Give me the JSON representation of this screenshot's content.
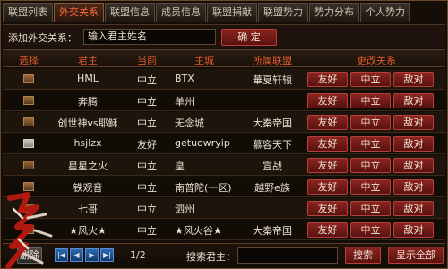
{
  "tabs": [
    "联盟列表",
    "外交关系",
    "联盟信息",
    "成员信息",
    "联盟捐献",
    "联盟势力",
    "势力分布",
    "个人势力"
  ],
  "add": {
    "label": "添加外交关系：",
    "input_value": "输入君主姓名",
    "confirm": "确 定"
  },
  "headers": {
    "select": "选择",
    "lord": "君主",
    "current": "当前",
    "city": "主城",
    "alliance": "所属联盟",
    "change": "更改关系"
  },
  "actions": {
    "friend": "友好",
    "neutral": "中立",
    "hostile": "敌对"
  },
  "rows": [
    {
      "lord": "HML",
      "current": "中立",
      "city": "BTX",
      "alliance": "華夏轩辕",
      "light": false
    },
    {
      "lord": "奔腾",
      "current": "中立",
      "city": "单州",
      "alliance": "",
      "light": false
    },
    {
      "lord": "创世神vs耶稣",
      "current": "中立",
      "city": "无念城",
      "alliance": "大秦帝国",
      "light": false
    },
    {
      "lord": "hsjlzx",
      "current": "友好",
      "city": "getuowryip",
      "alliance": "慕容天下",
      "light": true
    },
    {
      "lord": "星星之火",
      "current": "中立",
      "city": "皇",
      "alliance": "宣战",
      "light": false
    },
    {
      "lord": "铁观音",
      "current": "中立",
      "city": "南普陀(一区)",
      "alliance": "越野e族",
      "light": false
    },
    {
      "lord": "七哥",
      "current": "中立",
      "city": "泗州",
      "alliance": "",
      "light": false
    },
    {
      "lord": "★风火★",
      "current": "中立",
      "city": "★风火谷★",
      "alliance": "大秦帝国",
      "light": false
    }
  ],
  "footer": {
    "delete": "删除",
    "page": "1/2",
    "search_label": "搜索君主：",
    "search_value": "",
    "search_btn": "搜索",
    "show_all": "显示全部"
  },
  "logo_text": "仙魔天下",
  "colors": {
    "accent": "#e05a2a",
    "button_red": "#8a2420",
    "button_gray": "#4a4644",
    "panel": "#150d08"
  }
}
